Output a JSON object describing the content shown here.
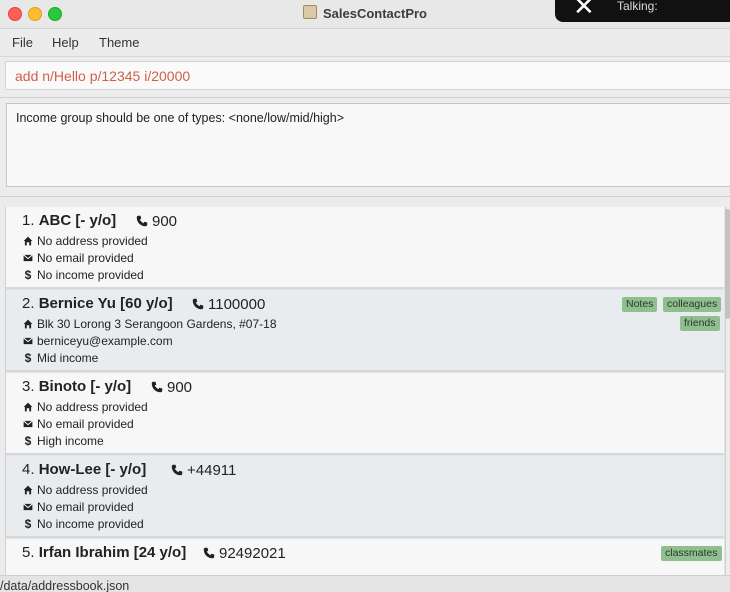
{
  "window": {
    "title": "SalesContactPro"
  },
  "notification": {
    "text": "Talking:"
  },
  "menu": {
    "items": [
      "File",
      "Help",
      "Theme"
    ]
  },
  "command": {
    "value": "add n/Hello p/12345 i/20000"
  },
  "result": {
    "message": "Income group should be one of types: <none/low/mid/high>"
  },
  "persons": [
    {
      "index": "1.",
      "name": "ABC [- y/o]",
      "phone": "900",
      "address": "No address provided",
      "email": "No email provided",
      "income": "No income provided",
      "tags": []
    },
    {
      "index": "2.",
      "name": "Bernice Yu [60 y/o]",
      "phone": "1100000",
      "address": "Blk 30 Lorong 3 Serangoon Gardens, #07-18",
      "email": "berniceyu@example.com",
      "income": "Mid income",
      "tags": [
        "Notes",
        "colleagues",
        "friends"
      ]
    },
    {
      "index": "3.",
      "name": "Binoto [- y/o]",
      "phone": "900",
      "address": "No address provided",
      "email": "No email provided",
      "income": "High income",
      "tags": []
    },
    {
      "index": "4.",
      "name": "How-Lee [- y/o]",
      "phone": "+44911",
      "address": "No address provided",
      "email": "No email provided",
      "income": "No income provided",
      "tags": []
    },
    {
      "index": "5.",
      "name": "Irfan Ibrahim [24 y/o]",
      "phone": "92492021",
      "address": "",
      "email": "",
      "income": "",
      "tags": [
        "classmates"
      ]
    }
  ],
  "status": {
    "path": "/data/addressbook.json"
  },
  "colors": {
    "command_text": "#d0604a",
    "tag_bg": "#8fbf8f",
    "card_alt": "#e9ecef"
  }
}
